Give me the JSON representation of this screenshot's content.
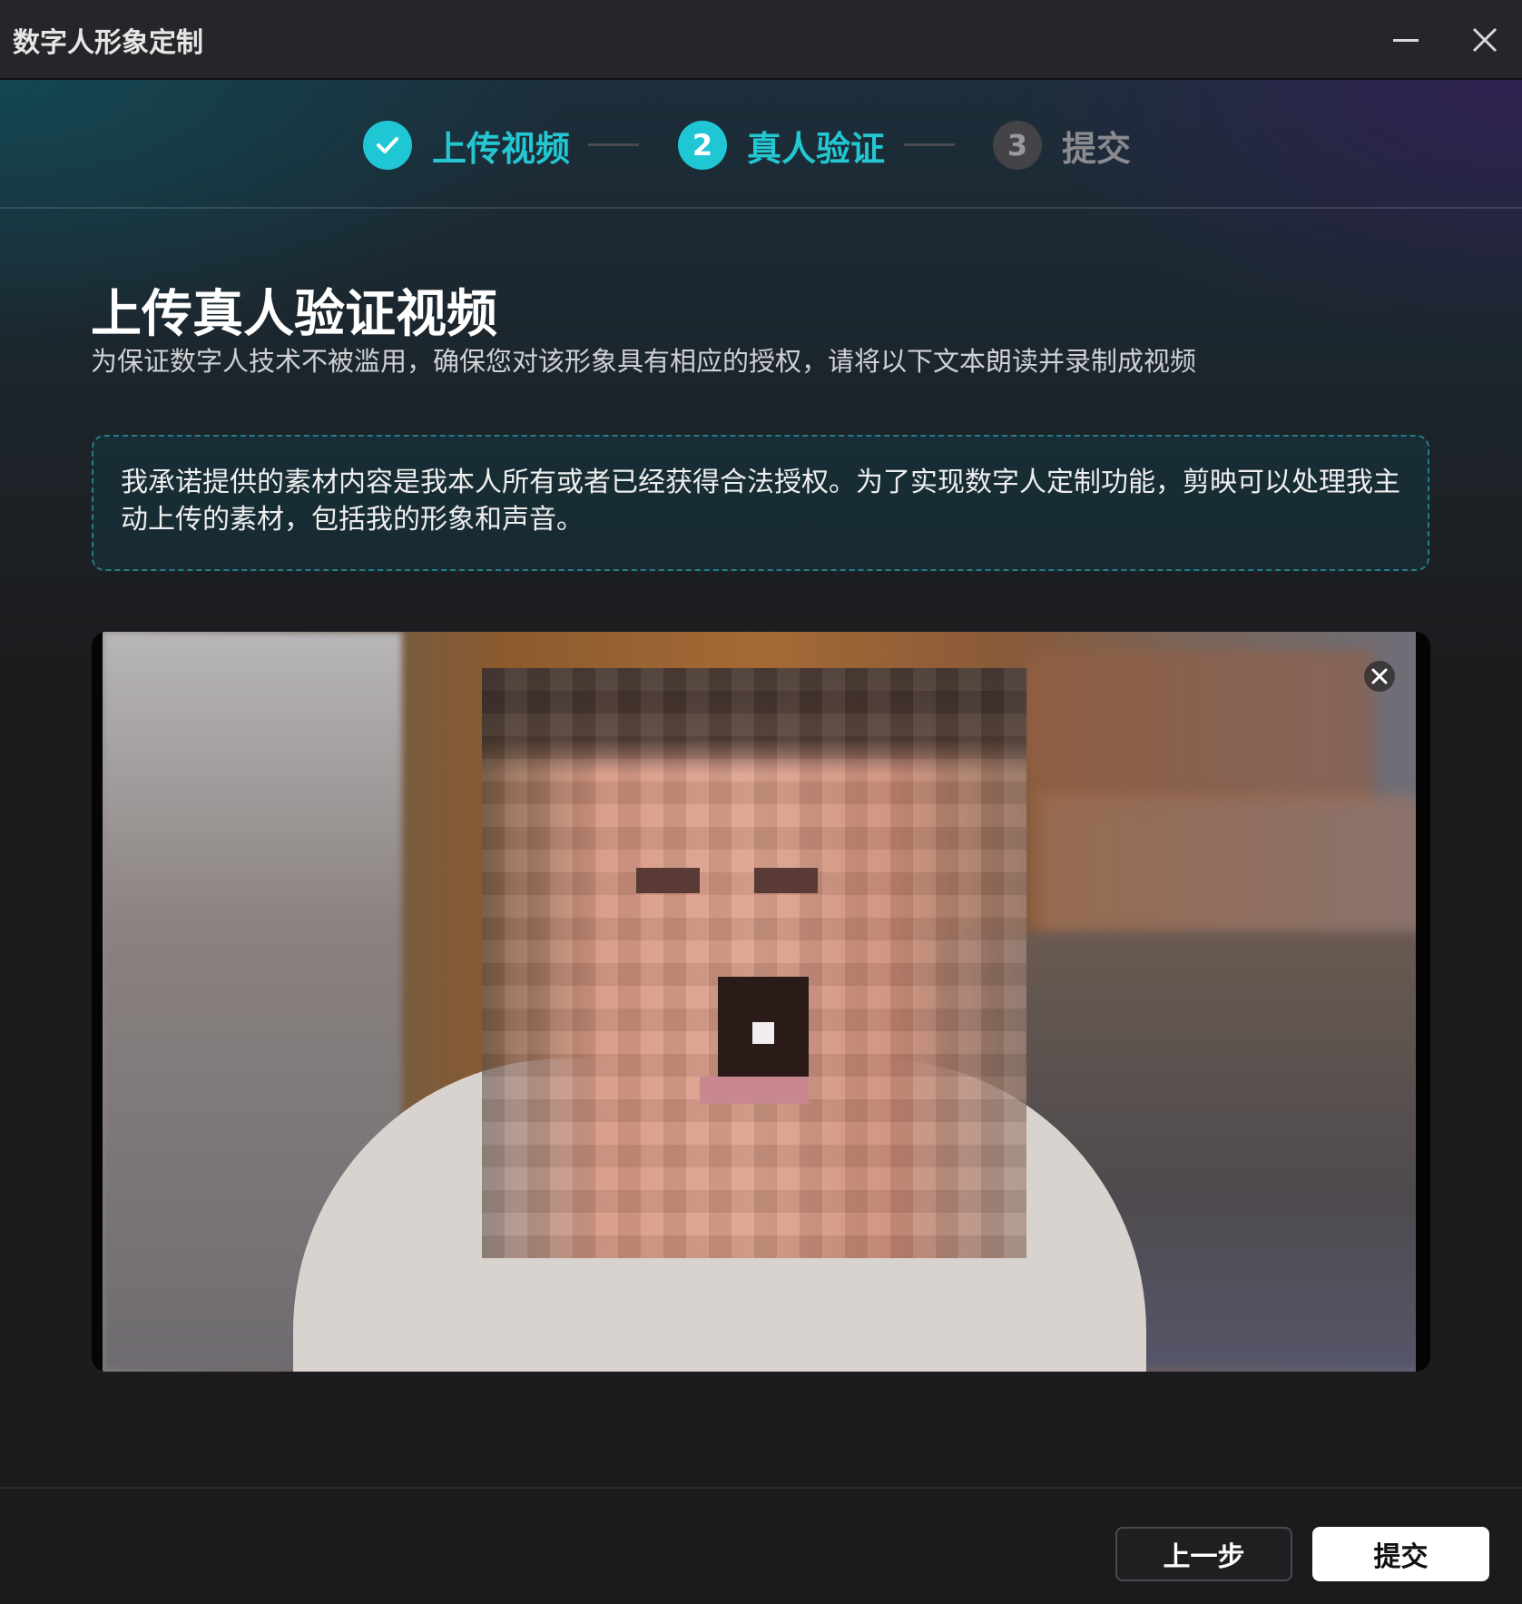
{
  "window": {
    "title": "数字人形象定制"
  },
  "stepper": {
    "steps": [
      {
        "number": "",
        "label": "上传视频",
        "state": "done"
      },
      {
        "number": "2",
        "label": "真人验证",
        "state": "active"
      },
      {
        "number": "3",
        "label": "提交",
        "state": "pending"
      }
    ]
  },
  "main": {
    "heading": "上传真人验证视频",
    "subtitle": "为保证数字人技术不被滥用，确保您对该形象具有相应的授权，请将以下文本朗读并录制成视频",
    "pledge_text": "我承诺提供的素材内容是我本人所有或者已经获得合法授权。为了实现数字人定制功能，剪映可以处理我主动上传的素材，包括我的形象和声音。"
  },
  "footer": {
    "prev_label": "上一步",
    "submit_label": "提交"
  },
  "colors": {
    "accent": "#1fc7d4",
    "pending": "#434348",
    "background": "#1c1c1e"
  },
  "icons": {
    "minimize": "minimize-icon",
    "close": "close-icon",
    "check": "check-icon",
    "video_remove": "close-icon"
  }
}
